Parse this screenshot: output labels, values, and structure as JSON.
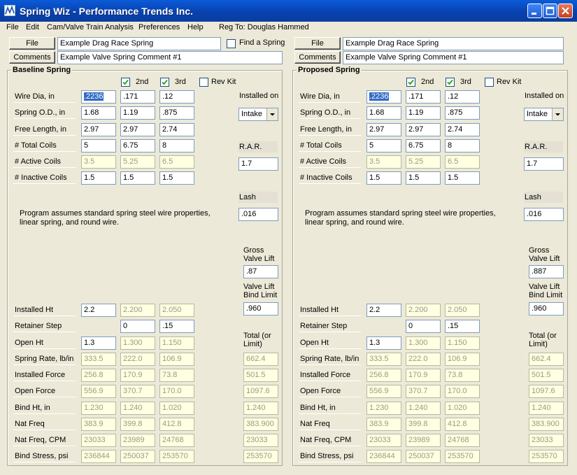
{
  "window": {
    "title": "Spring Wiz - Performance Trends Inc."
  },
  "menu": {
    "items": [
      "File",
      "Edit",
      "Cam/Valve Train Analysis",
      "Preferences",
      "Help"
    ],
    "registration": "Reg To: Douglas Hammed"
  },
  "left": {
    "file_button": "File",
    "file_value": "Example Drag Race Spring",
    "comments_button": "Comments",
    "comments_value": "Example Valve Spring Comment #1",
    "find_spring_label": "Find a Spring",
    "find_spring_checked": false
  },
  "right": {
    "file_button": "File",
    "file_value": "Example Drag Race Spring",
    "comments_button": "Comments",
    "comments_value": "Example Valve Spring Comment #1"
  },
  "panels": [
    {
      "title": "Baseline Spring",
      "chk_2nd": {
        "label": "2nd",
        "checked": true
      },
      "chk_3rd": {
        "label": "3rd",
        "checked": true
      },
      "chk_revkit": {
        "label": "Rev Kit",
        "checked": false
      },
      "top_rows": [
        {
          "label": "Wire Dia, in",
          "v": [
            ".2236",
            ".171",
            ".12"
          ]
        },
        {
          "label": "Spring O.D., in",
          "v": [
            "1.68",
            "1.19",
            ".875"
          ]
        },
        {
          "label": "Free Length, in",
          "v": [
            "2.97",
            "2.97",
            "2.74"
          ]
        },
        {
          "label": "# Total Coils",
          "v": [
            "5",
            "6.75",
            "8"
          ]
        },
        {
          "label": "# Active Coils",
          "v": [
            "3.5",
            "5.25",
            "6.5"
          ]
        },
        {
          "label": "# Inactive Coils",
          "v": [
            "1.5",
            "1.5",
            "1.5"
          ]
        }
      ],
      "installed_on_label": "Installed on",
      "installed_on_value": "Intake",
      "rar_label": "R.A.R.",
      "rar_value": "1.7",
      "lash_label": "Lash",
      "lash_value": ".016",
      "note": "Program assumes standard spring steel wire properties, linear spring, and round wire.",
      "gross_lift_label_1": "Gross",
      "gross_lift_label_2": "Valve Lift",
      "gross_lift_value": ".87",
      "bind_limit_label_1": "Valve Lift",
      "bind_limit_label_2": "Bind Limit",
      "bind_limit_value": ".960",
      "total_label_1": "Total (or",
      "total_label_2": "Limit)",
      "installed_ht": {
        "label": "Installed Ht",
        "v": [
          "2.2",
          "2.200",
          "2.050"
        ]
      },
      "retainer_step": {
        "label": "Retainer Step",
        "v": [
          "0",
          ".15"
        ]
      },
      "open_ht": {
        "label": "Open Ht",
        "v": [
          "1.3",
          "1.300",
          "1.150"
        ]
      },
      "bottom_rows": [
        {
          "label": "Spring Rate, lb/in",
          "v": [
            "333.5",
            "222.0",
            "106.9"
          ],
          "total": "662.4"
        },
        {
          "label": "Installed Force",
          "v": [
            "256.8",
            "170.9",
            "73.8"
          ],
          "total": "501.5"
        },
        {
          "label": "Open Force",
          "v": [
            "556.9",
            "370.7",
            "170.0"
          ],
          "total": "1097.6"
        },
        {
          "label": "Bind Ht, in",
          "v": [
            "1.230",
            "1.240",
            "1.020"
          ],
          "total": "1.240"
        },
        {
          "label": "Nat Freq",
          "v": [
            "383.9",
            "399.8",
            "412.8"
          ],
          "total": "383.900"
        },
        {
          "label": "Nat Freq, CPM",
          "v": [
            "23033",
            "23989",
            "24768"
          ],
          "total": "23033"
        },
        {
          "label": "Bind Stress, psi",
          "v": [
            "236844",
            "250037",
            "253570"
          ],
          "total": "253570"
        }
      ]
    },
    {
      "title": "Proposed Spring",
      "chk_2nd": {
        "label": "2nd",
        "checked": true
      },
      "chk_3rd": {
        "label": "3rd",
        "checked": true
      },
      "chk_revkit": {
        "label": "Rev Kit",
        "checked": false
      },
      "top_rows": [
        {
          "label": "Wire Dia, in",
          "v": [
            ".2236",
            ".171",
            ".12"
          ]
        },
        {
          "label": "Spring O.D., in",
          "v": [
            "1.68",
            "1.19",
            ".875"
          ]
        },
        {
          "label": "Free Length, in",
          "v": [
            "2.97",
            "2.97",
            "2.74"
          ]
        },
        {
          "label": "# Total Coils",
          "v": [
            "5",
            "6.75",
            "8"
          ]
        },
        {
          "label": "# Active Coils",
          "v": [
            "3.5",
            "5.25",
            "6.5"
          ]
        },
        {
          "label": "# Inactive Coils",
          "v": [
            "1.5",
            "1.5",
            "1.5"
          ]
        }
      ],
      "installed_on_label": "Installed on",
      "installed_on_value": "Intake",
      "rar_label": "R.A.R.",
      "rar_value": "1.7",
      "lash_label": "Lash",
      "lash_value": ".016",
      "note": "Program assumes standard spring steel wire properties, linear spring, and round wire.",
      "gross_lift_label_1": "Gross",
      "gross_lift_label_2": "Valve Lift",
      "gross_lift_value": ".887",
      "bind_limit_label_1": "Valve Lift",
      "bind_limit_label_2": "Bind Limit",
      "bind_limit_value": ".960",
      "total_label_1": "Total (or",
      "total_label_2": "Limit)",
      "installed_ht": {
        "label": "Installed Ht",
        "v": [
          "2.2",
          "2.200",
          "2.050"
        ]
      },
      "retainer_step": {
        "label": "Retainer Step",
        "v": [
          "0",
          ".15"
        ]
      },
      "open_ht": {
        "label": "Open Ht",
        "v": [
          "1.3",
          "1.300",
          "1.150"
        ]
      },
      "bottom_rows": [
        {
          "label": "Spring Rate, lb/in",
          "v": [
            "333.5",
            "222.0",
            "106.9"
          ],
          "total": "662.4"
        },
        {
          "label": "Installed Force",
          "v": [
            "256.8",
            "170.9",
            "73.8"
          ],
          "total": "501.5"
        },
        {
          "label": "Open Force",
          "v": [
            "556.9",
            "370.7",
            "170.0"
          ],
          "total": "1097.6"
        },
        {
          "label": "Bind Ht, in",
          "v": [
            "1.230",
            "1.240",
            "1.020"
          ],
          "total": "1.240"
        },
        {
          "label": "Nat Freq",
          "v": [
            "383.9",
            "399.8",
            "412.8"
          ],
          "total": "383.900"
        },
        {
          "label": "Nat Freq, CPM",
          "v": [
            "23033",
            "23989",
            "24768"
          ],
          "total": "23033"
        },
        {
          "label": "Bind Stress, psi",
          "v": [
            "236844",
            "250037",
            "253570"
          ],
          "total": "253570"
        }
      ]
    }
  ]
}
